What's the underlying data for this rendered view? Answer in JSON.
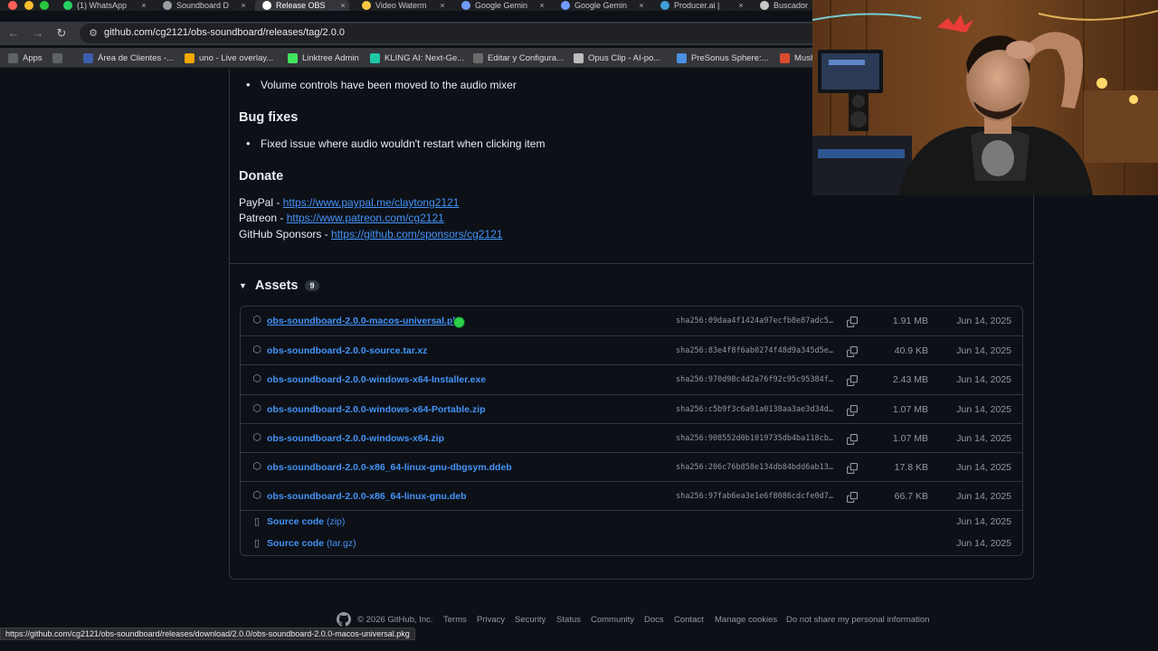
{
  "browser": {
    "tabs": [
      {
        "label": "(1) WhatsApp",
        "active": false,
        "color": "#25d366"
      },
      {
        "label": "Soundboard D",
        "active": false,
        "color": "#9aa0a6"
      },
      {
        "label": "Release OBS",
        "active": true,
        "color": "#ffffff"
      },
      {
        "label": "Video Waterm",
        "active": false,
        "color": "#f6c744"
      },
      {
        "label": "Google Gemin",
        "active": false,
        "color": "#6f9cf8"
      },
      {
        "label": "Google Gemin",
        "active": false,
        "color": "#6f9cf8"
      },
      {
        "label": "Producer.ai |",
        "active": false,
        "color": "#3fa0d8"
      },
      {
        "label": "Buscador",
        "active": false,
        "color": "#c9c9c9"
      }
    ],
    "tab_close_glyph": "×",
    "url": "github.com/cg2121/obs-soundboard/releases/tag/2.0.0",
    "bookmarks": [
      {
        "label": "Apps",
        "color": "#5f6368"
      },
      {
        "label": "",
        "color": "#5f6368"
      },
      {
        "label": "Área de Clientes -...",
        "color": "#3b5dab"
      },
      {
        "label": "uno - Live overlay...",
        "color": "#f2a900"
      },
      {
        "label": "Linktree Admin",
        "color": "#43e55e"
      },
      {
        "label": "KLING AI: Next-Ge...",
        "color": "#1ec8a5"
      },
      {
        "label": "Editar y Configura...",
        "color": "#6b6b6b"
      },
      {
        "label": "Opus Clip - AI-po...",
        "color": "#bdbdbd"
      },
      {
        "label": "PreSonus Sphere:...",
        "color": "#4a90e2"
      },
      {
        "label": "Mush",
        "color": "#d84b2f"
      }
    ]
  },
  "release": {
    "bullet_volume": "Volume controls have been moved to the audio mixer",
    "bug_fixes_heading": "Bug fixes",
    "bullet_bugfix": "Fixed issue where audio wouldn't restart when clicking item",
    "donate_heading": "Donate",
    "donate": [
      {
        "prefix": "PayPal - ",
        "link": "https://www.paypal.me/claytong2121"
      },
      {
        "prefix": "Patreon - ",
        "link": "https://www.patreon.com/cg2121"
      },
      {
        "prefix": "GitHub Sponsors - ",
        "link": "https://github.com/sponsors/cg2121"
      }
    ]
  },
  "assets": {
    "title": "Assets",
    "count": "9",
    "rows": [
      {
        "name": "obs-soundboard-2.0.0-macos-universal.pkg",
        "sha": "sha256:09daa4f1424a97ecfb8e87adc5…",
        "size": "1.91 MB",
        "date": "Jun 14, 2025"
      },
      {
        "name": "obs-soundboard-2.0.0-source.tar.xz",
        "sha": "sha256:83e4f8f6ab0274f48d9a345d5e…",
        "size": "40.9 KB",
        "date": "Jun 14, 2025"
      },
      {
        "name": "obs-soundboard-2.0.0-windows-x64-Installer.exe",
        "sha": "sha256:970d98c4d2a76f92c95c95384f…",
        "size": "2.43 MB",
        "date": "Jun 14, 2025"
      },
      {
        "name": "obs-soundboard-2.0.0-windows-x64-Portable.zip",
        "sha": "sha256:c5b9f3c6a91a0138aa3ae3d34d…",
        "size": "1.07 MB",
        "date": "Jun 14, 2025"
      },
      {
        "name": "obs-soundboard-2.0.0-windows-x64.zip",
        "sha": "sha256:908552d0b1019735db4ba118cb…",
        "size": "1.07 MB",
        "date": "Jun 14, 2025"
      },
      {
        "name": "obs-soundboard-2.0.0-x86_64-linux-gnu-dbgsym.ddeb",
        "sha": "sha256:206c76b858e134db84bdd6ab13…",
        "size": "17.8 KB",
        "date": "Jun 14, 2025"
      },
      {
        "name": "obs-soundboard-2.0.0-x86_64-linux-gnu.deb",
        "sha": "sha256:97fab6ea3e1e6f8086cdcfe0d7…",
        "size": "66.7 KB",
        "date": "Jun 14, 2025"
      }
    ],
    "source": [
      {
        "name": "Source code",
        "ext": "(zip)",
        "date": "Jun 14, 2025"
      },
      {
        "name": "Source code",
        "ext": "(tar.gz)",
        "date": "Jun 14, 2025"
      }
    ]
  },
  "footer": {
    "copyright": "© 2026 GitHub, Inc.",
    "links": [
      "Terms",
      "Privacy",
      "Security",
      "Status",
      "Community",
      "Docs",
      "Contact",
      "Manage cookies",
      "Do not share my personal information"
    ]
  },
  "status_url": "https://github.com/cg2121/obs-soundboard/releases/download/2.0.0/obs-soundboard-2.0.0-macos-universal.pkg",
  "colors": {
    "link": "#4493f8",
    "bg": "#0d1117",
    "border": "#30363d",
    "muted": "#9198a1"
  }
}
